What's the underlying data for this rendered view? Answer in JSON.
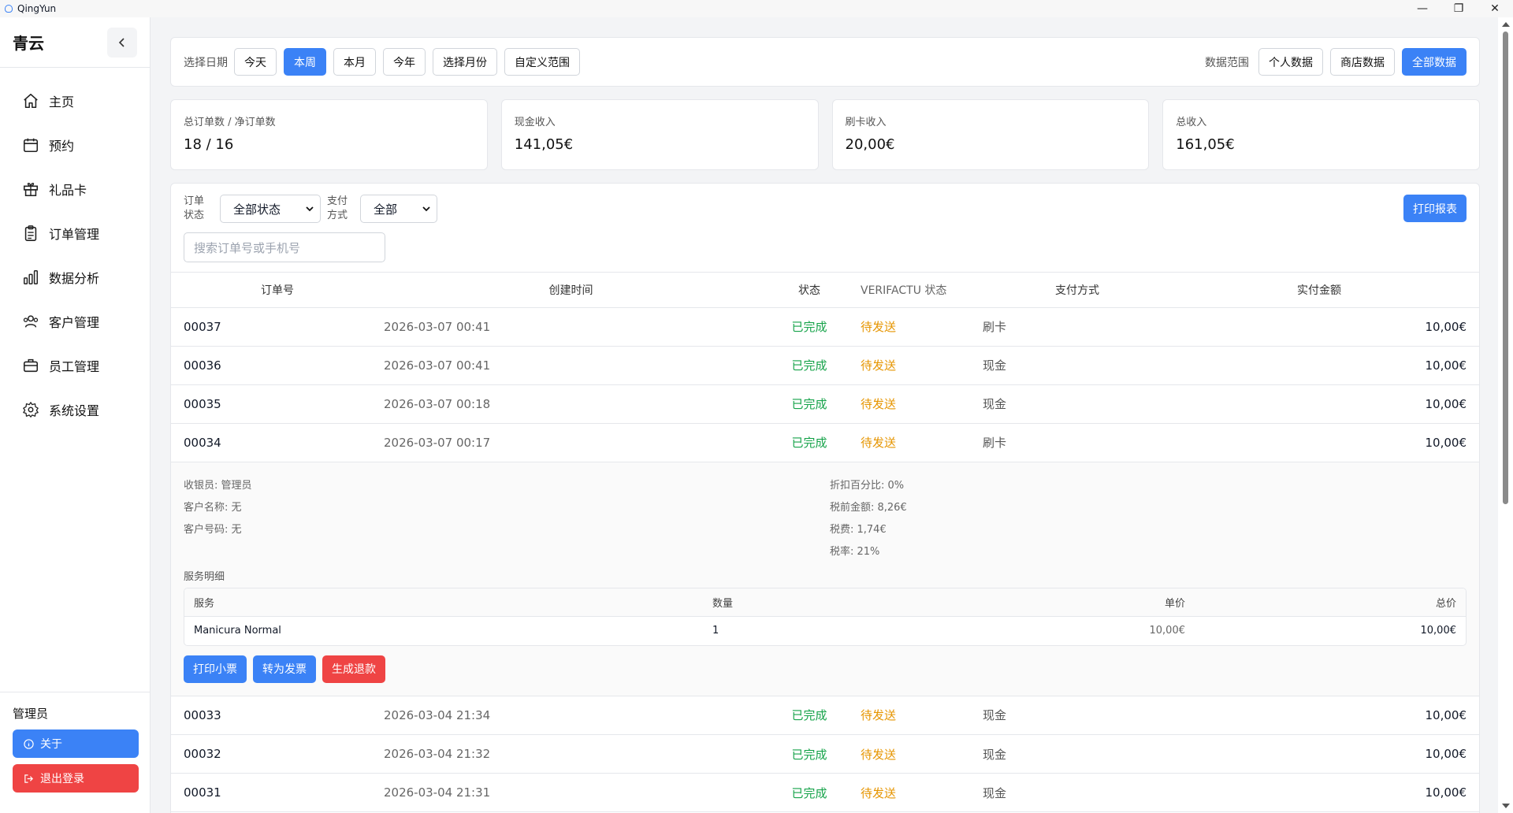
{
  "window": {
    "title": "QingYun"
  },
  "sidebar": {
    "brand": "青云",
    "items": [
      {
        "label": "主页",
        "icon": "home-icon"
      },
      {
        "label": "预约",
        "icon": "calendar-icon"
      },
      {
        "label": "礼品卡",
        "icon": "gift-icon"
      },
      {
        "label": "订单管理",
        "icon": "clipboard-icon"
      },
      {
        "label": "数据分析",
        "icon": "bar-chart-icon"
      },
      {
        "label": "客户管理",
        "icon": "users-icon"
      },
      {
        "label": "员工管理",
        "icon": "briefcase-icon"
      },
      {
        "label": "系统设置",
        "icon": "gear-icon"
      }
    ],
    "user": "管理员",
    "about_label": "关于",
    "logout_label": "退出登录"
  },
  "filters": {
    "date_label": "选择日期",
    "date_buttons": [
      "今天",
      "本周",
      "本月",
      "今年",
      "选择月份",
      "自定义范围"
    ],
    "active_date": "本周",
    "scope_label": "数据范围",
    "scope_buttons": [
      "个人数据",
      "商店数据",
      "全部数据"
    ],
    "active_scope": "全部数据"
  },
  "stats": [
    {
      "label": "总订单数 / 净订单数",
      "value": "18 / 16"
    },
    {
      "label": "现金收入",
      "value": "141,05€"
    },
    {
      "label": "刷卡收入",
      "value": "20,00€"
    },
    {
      "label": "总收入",
      "value": "161,05€"
    }
  ],
  "orders": {
    "status_label_1": "订单",
    "status_label_2": "状态",
    "status_value": "全部状态",
    "pay_label_1": "支付",
    "pay_label_2": "方式",
    "pay_value": "全部",
    "search_placeholder": "搜索订单号或手机号",
    "print_report": "打印报表",
    "headers": {
      "no": "订单号",
      "time": "创建时间",
      "status": "状态",
      "verifactu": "VERIFACTU 状态",
      "pay": "支付方式",
      "amount": "实付金额"
    },
    "rows_top": [
      {
        "no": "00037",
        "time": "2026-03-07 00:41",
        "status": "已完成",
        "vf": "待发送",
        "pay": "刷卡",
        "amount": "10,00€"
      },
      {
        "no": "00036",
        "time": "2026-03-07 00:41",
        "status": "已完成",
        "vf": "待发送",
        "pay": "现金",
        "amount": "10,00€"
      },
      {
        "no": "00035",
        "time": "2026-03-07 00:18",
        "status": "已完成",
        "vf": "待发送",
        "pay": "现金",
        "amount": "10,00€"
      },
      {
        "no": "00034",
        "time": "2026-03-07 00:17",
        "status": "已完成",
        "vf": "待发送",
        "pay": "刷卡",
        "amount": "10,00€"
      }
    ],
    "detail": {
      "cashier": "收银员: 管理员",
      "customer_name": "客户名称: 无",
      "customer_no": "客户号码: 无",
      "discount": "折扣百分比: 0%",
      "pretax": "税前金额: 8,26€",
      "tax": "税费: 1,74€",
      "tax_rate": "税率: 21%",
      "services_title": "服务明细",
      "svc_headers": {
        "name": "服务",
        "qty": "数量",
        "unit": "单价",
        "total": "总价"
      },
      "services": [
        {
          "name": "Manicura Normal",
          "qty": "1",
          "unit": "10,00€",
          "total": "10,00€"
        }
      ],
      "actions": {
        "print": "打印小票",
        "invoice": "转为发票",
        "refund": "生成退款"
      }
    },
    "rows_bottom": [
      {
        "no": "00033",
        "time": "2026-03-04 21:34",
        "status": "已完成",
        "vf": "待发送",
        "pay": "现金",
        "amount": "10,00€"
      },
      {
        "no": "00032",
        "time": "2026-03-04 21:32",
        "status": "已完成",
        "vf": "待发送",
        "pay": "现金",
        "amount": "10,00€"
      },
      {
        "no": "00031",
        "time": "2026-03-04 21:31",
        "status": "已完成",
        "vf": "待发送",
        "pay": "现金",
        "amount": "10,00€"
      }
    ]
  },
  "colors": {
    "accent": "#3b82f6",
    "danger": "#ef4444",
    "success": "#16a34a",
    "pending": "#e69500"
  }
}
